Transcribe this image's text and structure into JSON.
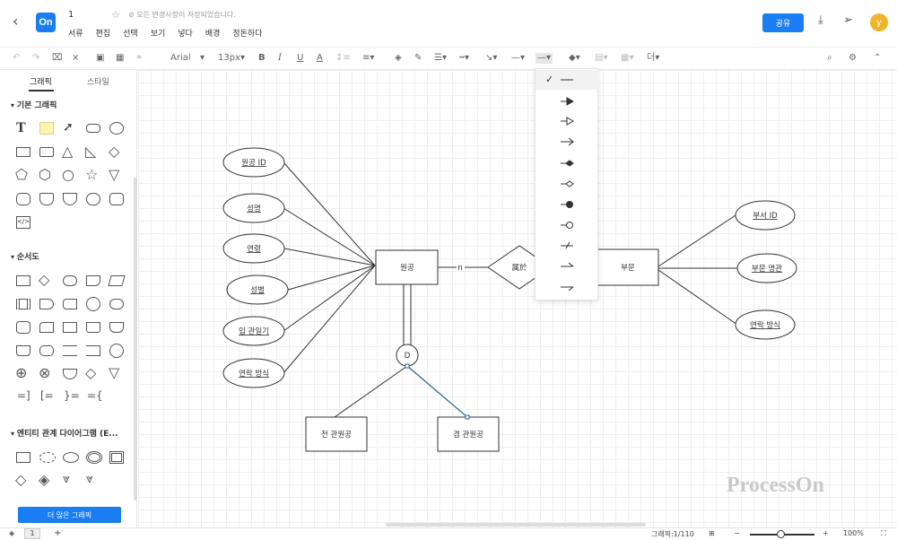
{
  "header": {
    "doc_title": "1",
    "save_status": "모든 변경사항이 저장되었습니다.",
    "share_label": "공유",
    "avatar_letter": "y",
    "logo_text": "On"
  },
  "menu": [
    "서류",
    "편집",
    "선택",
    "보기",
    "넣다",
    "배경",
    "정돈하다"
  ],
  "toolbar": {
    "font": "Arial",
    "font_size": "13px",
    "bold": "B",
    "italic": "I",
    "underline": "U",
    "font_color": "A",
    "more": "더"
  },
  "sidebar": {
    "tabs": [
      "그래픽",
      "스타일"
    ],
    "sections": [
      "기본 그래픽",
      "순서도",
      "엔티티 관계 다이어그램 (E..."
    ],
    "more_button": "더 많은 그래픽",
    "text_shape": "T",
    "code_shape": "</>"
  },
  "diagram": {
    "attributes_left": [
      "원공 ID",
      "성명",
      "연령",
      "성별",
      "입 관일기",
      "연락 방식"
    ],
    "entity_employee": "원공",
    "relationship": "属於",
    "cardinality": "n",
    "entity_dept": "부문",
    "attributes_right": [
      "부서 ID",
      "부문 명관",
      "연락 방식"
    ],
    "disjoint": "D",
    "sub_former": "전 관원공",
    "sub_current": "겸 관원공"
  },
  "watermark": "ProcessOn",
  "statusbar": {
    "page": "1",
    "add": "+",
    "shape_count": "그래픽:1/110",
    "zoom": "100%"
  },
  "icons": [
    "back-icon",
    "star-icon",
    "download-icon",
    "send-icon",
    "undo-icon",
    "redo-icon",
    "format-painter-icon",
    "check-icon"
  ]
}
